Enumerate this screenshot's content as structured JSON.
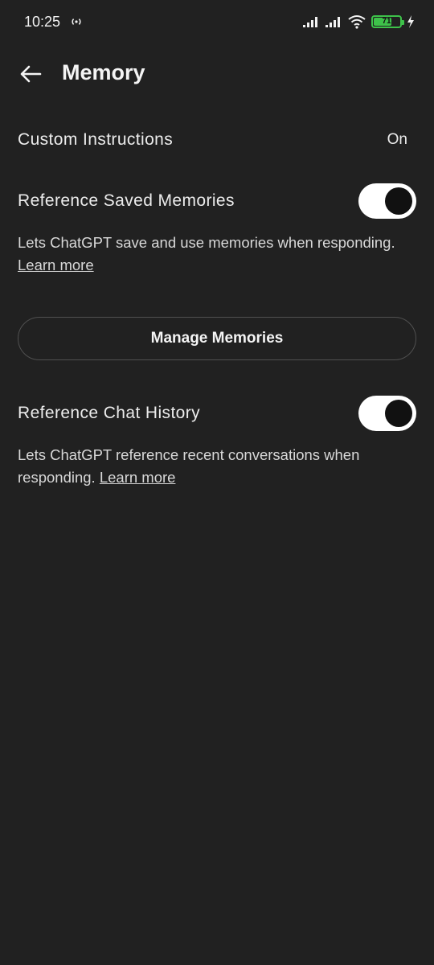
{
  "status_bar": {
    "time": "10:25",
    "hotspot_icon": "hotspot-icon",
    "signal_icons": [
      "signal-bars-icon",
      "signal-bars-icon"
    ],
    "wifi_icon": "wifi-icon",
    "battery_level": "71",
    "battery_fraction": 0.71,
    "charging_icon": "charging-bolt-icon",
    "battery_color": "#3ec24a"
  },
  "header": {
    "back_icon": "arrow-left-icon",
    "title": "Memory"
  },
  "settings": {
    "custom_instructions": {
      "label": "Custom Instructions",
      "value": "On"
    },
    "saved_memories": {
      "label": "Reference Saved Memories",
      "enabled": true,
      "description": "Lets ChatGPT save and use memories when responding.",
      "learn_more": "Learn more"
    },
    "manage_button": "Manage Memories",
    "chat_history": {
      "label": "Reference Chat History",
      "enabled": true,
      "description": "Lets ChatGPT reference recent conversations when responding.",
      "learn_more": "Learn more"
    }
  },
  "colors": {
    "background": "#212121",
    "text": "#ececec",
    "toggle_track": "#ffffff",
    "toggle_knob": "#111111"
  }
}
